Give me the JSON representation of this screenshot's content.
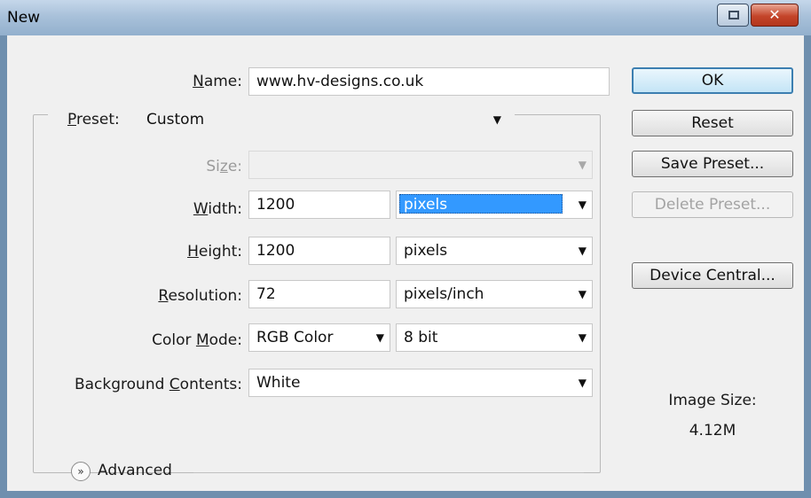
{
  "window": {
    "title": "New"
  },
  "fields": {
    "name": {
      "label": "Name:",
      "value": "www.hv-designs.co.uk"
    },
    "preset": {
      "label": "Preset:",
      "value": "Custom"
    },
    "size": {
      "label": "Size:",
      "value": ""
    },
    "width": {
      "label": "Width:",
      "value": "1200",
      "unit": "pixels"
    },
    "height": {
      "label": "Height:",
      "value": "1200",
      "unit": "pixels"
    },
    "resolution": {
      "label": "Resolution:",
      "value": "72",
      "unit": "pixels/inch"
    },
    "color_mode": {
      "label": "Color Mode:",
      "value": "RGB Color",
      "depth": "8 bit"
    },
    "background": {
      "label": "Background Contents:",
      "value": "White"
    },
    "advanced": {
      "label": "Advanced"
    }
  },
  "buttons": {
    "ok": "OK",
    "reset": "Reset",
    "save_preset": "Save Preset...",
    "delete_preset": "Delete Preset...",
    "device_central": "Device Central..."
  },
  "image_size": {
    "label": "Image Size:",
    "value": "4.12M"
  },
  "icons": {
    "dropdown": "chevron-down-icon",
    "advanced": "double-chevron-down-icon",
    "close": "close-icon",
    "restore": "restore-icon"
  },
  "colors": {
    "selection": "#3399ff",
    "titlebar": "#a9c1da",
    "close_button": "#c4452a"
  }
}
